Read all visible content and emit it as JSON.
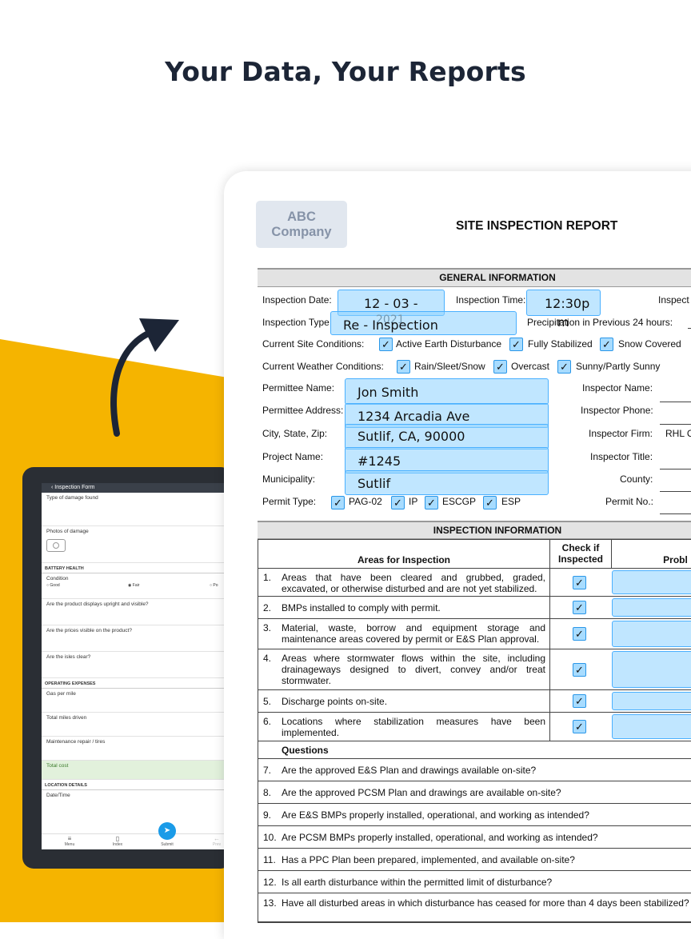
{
  "hero": {
    "title": "Your Data, Your Reports"
  },
  "mobile": {
    "appbar": "‹  Inspection Form",
    "fields": [
      "Type of damage found",
      "Photos of damage"
    ],
    "section_battery": "BATTERY HEALTH",
    "condition_label": "Condition",
    "condition_options": [
      "Good",
      "Fair",
      "Po"
    ],
    "questions": [
      "Are the product displays upright and visible?",
      "Are the prices visible on the product?",
      "Are the isles clear?"
    ],
    "section_expenses": "OPERATING EXPENSES",
    "expense_fields": [
      "Gas per mile",
      "Total miles driven",
      "Maintenance repair / tires"
    ],
    "total_cost": "Total cost",
    "section_location": "LOCATION DETAILS",
    "date_time": "Date/Time",
    "nav": [
      "Menu",
      "Index",
      "Submit",
      "Prev"
    ]
  },
  "report": {
    "logo_line1": "ABC",
    "logo_line2": "Company",
    "title": "SITE INSPECTION REPORT",
    "general_header": "GENERAL INFORMATION",
    "labels": {
      "inspection_date": "Inspection Date:",
      "inspection_time": "Inspection Time:",
      "inspector_cut": "Inspect",
      "inspection_type": "Inspection Type",
      "precip": "Precipitation in Previous 24 hours:",
      "site_conditions": "Current Site Conditions:",
      "weather": "Current Weather Conditions:",
      "permittee_name": "Permittee Name:",
      "inspector_name": "Inspector Name:",
      "permittee_address": "Permittee Address:",
      "inspector_phone": "Inspector Phone:",
      "city": "City, State, Zip:",
      "inspector_firm": "Inspector Firm:",
      "project": "Project Name:",
      "inspector_title": "Inspector Title:",
      "municipality": "Municipality:",
      "county": "County:",
      "permit_type": "Permit Type:",
      "permit_no": "Permit No.:"
    },
    "values": {
      "date": "12 - 03 -",
      "date_year": "2021",
      "time": "12:30p",
      "time_suffix": "m",
      "type": "Re - Inspection",
      "permittee": "Jon Smith",
      "address": "1234 Arcadia Ave",
      "city": "Sutlif, CA, 90000",
      "project": "#1245",
      "municipality": "Sutlif",
      "firm": "RHL C"
    },
    "site_conditions": [
      "Active Earth Disturbance",
      "Fully Stabilized",
      "Snow Covered"
    ],
    "weather": [
      "Rain/Sleet/Snow",
      "Overcast",
      "Sunny/Partly Sunny"
    ],
    "permit_types": [
      "PAG-02",
      "IP",
      "ESCGP",
      "ESP"
    ],
    "check": "✓",
    "inspection_header": "INSPECTION INFORMATION",
    "col_areas": "Areas for Inspection",
    "col_check_1": "Check if",
    "col_check_2": "Inspected",
    "col_problem": "Probl",
    "areas": [
      {
        "n": "1.",
        "t": "Areas that have been cleared and grubbed, graded, excavated, or otherwise disturbed and are not yet stabilized."
      },
      {
        "n": "2.",
        "t": "BMPs installed to comply with permit."
      },
      {
        "n": "3.",
        "t": "Material, waste, borrow and equipment storage and maintenance areas covered by permit or E&S Plan approval."
      },
      {
        "n": "4.",
        "t": "Areas where stormwater flows within the site, including drainageways designed to divert, convey and/or treat stormwater."
      },
      {
        "n": "5.",
        "t": "Discharge points on-site."
      },
      {
        "n": "6.",
        "t": "Locations where stabilization measures have been implemented."
      }
    ],
    "questions_header": "Questions",
    "questions": [
      {
        "n": "7.",
        "t": "Are the approved E&S Plan and drawings available on-site?"
      },
      {
        "n": "8.",
        "t": "Are the approved PCSM Plan and drawings are available on-site?"
      },
      {
        "n": "9.",
        "t": "Are E&S BMPs properly installed, operational, and working as intended?"
      },
      {
        "n": "10.",
        "t": "Are PCSM BMPs properly installed, operational, and working as intended?"
      },
      {
        "n": "11.",
        "t": "Has a PPC Plan been prepared, implemented, and available on-site?"
      },
      {
        "n": "12.",
        "t": "Is all earth disturbance within the permitted limit of disturbance?"
      },
      {
        "n": "13.",
        "t": "Have all disturbed areas in which disturbance has ceased for more than 4 days been stabilized?"
      }
    ]
  }
}
